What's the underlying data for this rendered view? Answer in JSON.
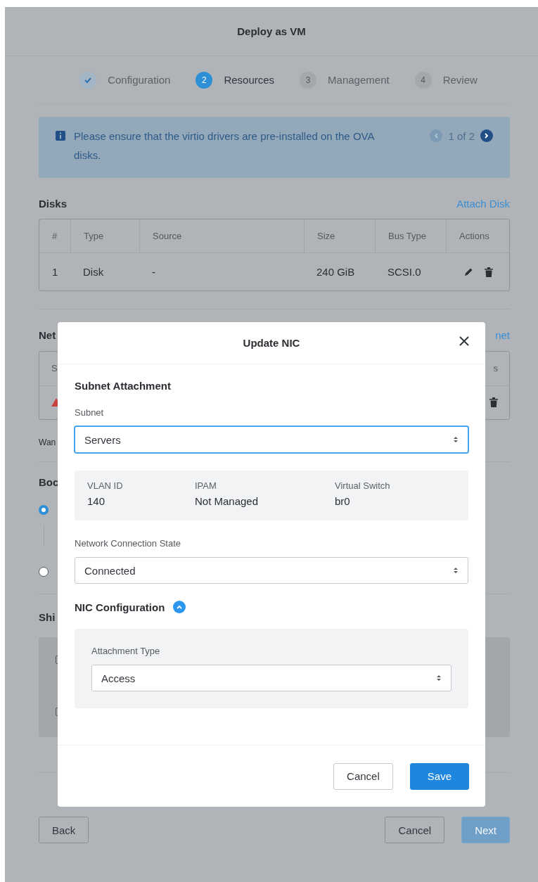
{
  "page": {
    "title": "Deploy as VM"
  },
  "steps": [
    {
      "label": "Configuration",
      "done": true,
      "selected": false
    },
    {
      "number": "2",
      "label": "Resources",
      "done": false,
      "selected": true
    },
    {
      "number": "3",
      "label": "Management",
      "done": false,
      "selected": false
    },
    {
      "number": "4",
      "label": "Review",
      "done": false,
      "selected": false
    }
  ],
  "banner": {
    "message": "Please ensure that the virtio drivers are pre-installed on the OVA disks.",
    "pager": "1 of 2",
    "prev_disabled": true,
    "next_disabled": false
  },
  "disks": {
    "title": "Disks",
    "action": "Attach Disk",
    "columns": [
      "#",
      "Type",
      "Source",
      "Size",
      "Bus Type",
      "Actions"
    ],
    "rows": [
      {
        "cells": [
          "1",
          "Disk",
          "-",
          "240 GiB",
          "SCSI.0"
        ]
      }
    ]
  },
  "network": {
    "title": "Net",
    "action": "net",
    "columns": [
      "S",
      "s"
    ],
    "rows": [
      {
        "warning": true
      }
    ]
  },
  "note": "Wan",
  "boot": {
    "title": "Boc",
    "options": [
      {
        "selected": true
      },
      {
        "selected": false
      }
    ]
  },
  "shield": {
    "title": "Shi",
    "options": [
      {
        "checked": false
      },
      {
        "checked": false
      }
    ]
  },
  "footer": {
    "back": "Back",
    "cancel": "Cancel",
    "next": "Next",
    "next_disabled": true
  },
  "dialog": {
    "title": "Update NIC",
    "section": "Subnet Attachment",
    "subnet": {
      "label": "Subnet",
      "value": "Servers",
      "focused": true
    },
    "details": [
      {
        "label": "VLAN ID",
        "value": "140"
      },
      {
        "label": "IPAM",
        "value": "Not Managed"
      },
      {
        "label": "Virtual Switch",
        "value": "br0"
      }
    ],
    "connection": {
      "label": "Network Connection State",
      "value": "Connected",
      "focused": false
    },
    "nic_config": {
      "title": "NIC Configuration",
      "expanded": true,
      "attachment": {
        "label": "Attachment Type",
        "value": "Access",
        "focused": false
      }
    },
    "buttons": {
      "cancel": "Cancel",
      "save": "Save"
    }
  }
}
